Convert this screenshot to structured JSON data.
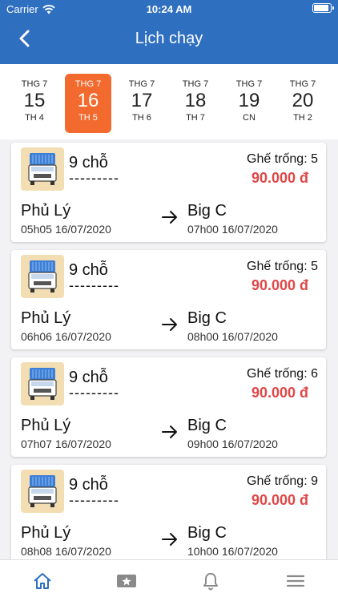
{
  "status_bar": {
    "carrier": "Carrier",
    "time": "10:24 AM"
  },
  "header": {
    "title": "Lịch chạy"
  },
  "dates": [
    {
      "month": "THG 7",
      "day": "15",
      "weekday": "TH 4",
      "selected": false
    },
    {
      "month": "THG 7",
      "day": "16",
      "weekday": "TH 5",
      "selected": true
    },
    {
      "month": "THG 7",
      "day": "17",
      "weekday": "TH 6",
      "selected": false
    },
    {
      "month": "THG 7",
      "day": "18",
      "weekday": "TH 7",
      "selected": false
    },
    {
      "month": "THG 7",
      "day": "19",
      "weekday": "CN",
      "selected": false
    },
    {
      "month": "THG 7",
      "day": "20",
      "weekday": "TH 2",
      "selected": false
    }
  ],
  "trips": [
    {
      "seats": "9 chỗ",
      "plate": "---------",
      "free_seats": "Ghế trống: 5",
      "price": "90.000 đ",
      "from_city": "Phủ Lý",
      "from_time": "05h05 16/07/2020",
      "to_city": "Big C",
      "to_time": "07h00 16/07/2020"
    },
    {
      "seats": "9 chỗ",
      "plate": "---------",
      "free_seats": "Ghế trống: 5",
      "price": "90.000 đ",
      "from_city": "Phủ Lý",
      "from_time": "06h06 16/07/2020",
      "to_city": "Big C",
      "to_time": "08h00 16/07/2020"
    },
    {
      "seats": "9 chỗ",
      "plate": "---------",
      "free_seats": "Ghế trống: 6",
      "price": "90.000 đ",
      "from_city": "Phủ Lý",
      "from_time": "07h07 16/07/2020",
      "to_city": "Big C",
      "to_time": "09h00 16/07/2020"
    },
    {
      "seats": "9 chỗ",
      "plate": "---------",
      "free_seats": "Ghế trống: 9",
      "price": "90.000 đ",
      "from_city": "Phủ Lý",
      "from_time": "08h08 16/07/2020",
      "to_city": "Big C",
      "to_time": "10h00 16/07/2020"
    }
  ],
  "tabbar": {
    "items": [
      "home-icon",
      "star-ticket-icon",
      "bell-icon",
      "menu-icon"
    ],
    "active_index": 0
  },
  "colors": {
    "header": "#2f6fc0",
    "selected_date": "#f26a2e",
    "price": "#e04848",
    "active_tab": "#2f6fc0",
    "inactive_tab": "#8a8a8a"
  }
}
